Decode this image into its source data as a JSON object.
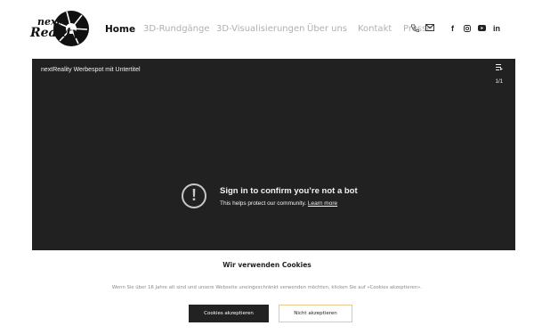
{
  "header": {
    "logo": {
      "line1": "next",
      "line2": "Reality"
    },
    "nav": [
      {
        "label": "Home",
        "active": true
      },
      {
        "label": "3D-Rundgänge",
        "active": false
      },
      {
        "label": "3D-Visualisierungen",
        "active": false
      },
      {
        "label": "Über uns",
        "active": false
      },
      {
        "label": "Kontakt",
        "active": false
      },
      {
        "label": "Presse",
        "active": false
      }
    ],
    "icons": [
      "phone-icon",
      "mail-icon"
    ],
    "social": [
      "facebook-icon",
      "instagram-icon",
      "youtube-icon",
      "linkedin-icon"
    ]
  },
  "video": {
    "title": "nextReality Werbespot mit Untertitel",
    "playlist_count": "1/1",
    "message_title": "Sign in to confirm you’re not a bot",
    "message_sub": "This helps protect our community.",
    "learn_more": "Learn more"
  },
  "cookie": {
    "title": "Wir verwenden Cookies",
    "text": "Wenn Sie über 16 Jahre alt sind und unsere Webseite uneingeschränkt verwenden möchten, klicken Sie auf «Cookies akzeptieren».",
    "accept": "Cookies akzeptieren",
    "decline": "Nicht akzeptieren"
  },
  "colors": {
    "nav_inactive": "#b0b0b0",
    "video_bg": "#212121",
    "accept_bg": "#222222",
    "decline_border": "#e8c98a"
  }
}
